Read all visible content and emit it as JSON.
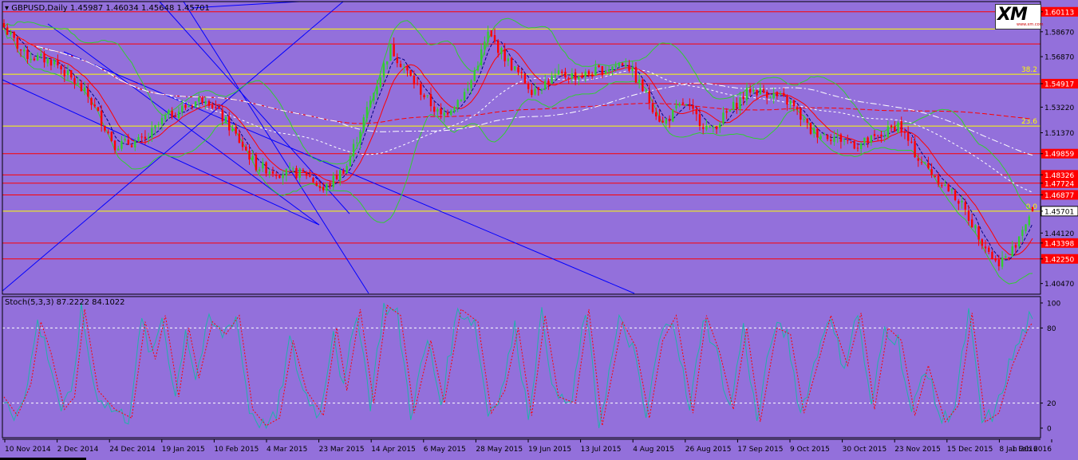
{
  "header": {
    "symbol_line": "GBPUSD,Daily  1.45987 1.46034 1.45648 1.45701"
  },
  "logo": {
    "brand": "XM",
    "url": "www.xm.com"
  },
  "colors": {
    "background": "#9370DB",
    "bull": "#32CD32",
    "bear": "#FF0000",
    "level_red": "#FF0000",
    "level_yellow": "#FFFF00",
    "trend_blue": "#0000FF",
    "ma_red": "#FF0000",
    "ma_dark": "#000080",
    "ma_white": "#FFFFFF",
    "bands": "#32CD32",
    "stoch_main": "#20B2AA",
    "stoch_signal": "#FF0000"
  },
  "chart_data": [
    {
      "type": "candlestick",
      "title": "GBPUSD,Daily",
      "ohlc_last": {
        "open": 1.45987,
        "high": 1.46034,
        "low": 1.45648,
        "close": 1.45701
      },
      "ylim": [
        1.397,
        1.6085
      ],
      "y_ticks": [
        "1.60113",
        "1.58670",
        "1.56870",
        "1.54917",
        "1.53220",
        "1.51370",
        "1.49859",
        "1.48326",
        "1.47724",
        "1.46877",
        "1.45701",
        "1.44120",
        "1.43398",
        "1.42250",
        "1.40470"
      ],
      "horizontal_levels": [
        {
          "value": 1.60113,
          "color": "red",
          "tag": true
        },
        {
          "value": 1.5887,
          "color": "yellow",
          "tag": false
        },
        {
          "value": 1.57787,
          "color": "red",
          "tag": true
        },
        {
          "value": 1.556,
          "color": "yellow",
          "tag": false,
          "label": "38.2"
        },
        {
          "value": 1.54917,
          "color": "red",
          "tag": true
        },
        {
          "value": 1.5185,
          "color": "yellow",
          "tag": false,
          "label": "23.6"
        },
        {
          "value": 1.49859,
          "color": "red",
          "tag": true
        },
        {
          "value": 1.48326,
          "color": "red",
          "tag": true
        },
        {
          "value": 1.47724,
          "color": "red",
          "tag": true
        },
        {
          "value": 1.46877,
          "color": "red",
          "tag": true
        },
        {
          "value": 1.45701,
          "color": "yellow",
          "tag": false,
          "label": "0.0"
        },
        {
          "value": 1.43398,
          "color": "red",
          "tag": true
        },
        {
          "value": 1.4225,
          "color": "red",
          "tag": true
        }
      ],
      "x_labels": [
        "10 Nov 2014",
        "2 Dec 2014",
        "24 Dec 2014",
        "19 Jan 2015",
        "10 Feb 2015",
        "4 Mar 2015",
        "23 Mar 2015",
        "14 Apr 2015",
        "6 May 2015",
        "28 May 2015",
        "19 Jun 2015",
        "13 Jul 2015",
        "4 Aug 2015",
        "26 Aug 2015",
        "17 Sep 2015",
        "9 Oct 2015",
        "30 Oct 2015",
        "23 Nov 2015",
        "15 Dec 2015",
        "8 Jan 2016",
        "1 Feb 2016"
      ],
      "close_path": [
        [
          0,
          1.59
        ],
        [
          6,
          1.57
        ],
        [
          15,
          1.565
        ],
        [
          25,
          1.54
        ],
        [
          33,
          1.505
        ],
        [
          42,
          1.508
        ],
        [
          48,
          1.525
        ],
        [
          60,
          1.54
        ],
        [
          68,
          1.515
        ],
        [
          75,
          1.49
        ],
        [
          82,
          1.485
        ],
        [
          90,
          1.484
        ],
        [
          95,
          1.472
        ],
        [
          102,
          1.49
        ],
        [
          108,
          1.53
        ],
        [
          115,
          1.575
        ],
        [
          122,
          1.55
        ],
        [
          130,
          1.525
        ],
        [
          138,
          1.545
        ],
        [
          144,
          1.585
        ],
        [
          150,
          1.565
        ],
        [
          157,
          1.545
        ],
        [
          165,
          1.555
        ],
        [
          172,
          1.555
        ],
        [
          179,
          1.56
        ],
        [
          185,
          1.565
        ],
        [
          190,
          1.545
        ],
        [
          196,
          1.52
        ],
        [
          202,
          1.535
        ],
        [
          210,
          1.515
        ],
        [
          216,
          1.53
        ],
        [
          222,
          1.545
        ],
        [
          228,
          1.542
        ],
        [
          234,
          1.535
        ],
        [
          240,
          1.515
        ],
        [
          248,
          1.51
        ],
        [
          254,
          1.505
        ],
        [
          260,
          1.51
        ],
        [
          266,
          1.52
        ],
        [
          272,
          1.495
        ],
        [
          278,
          1.48
        ],
        [
          284,
          1.465
        ],
        [
          290,
          1.44
        ],
        [
          295,
          1.42
        ],
        [
          299,
          1.424
        ],
        [
          303,
          1.445
        ],
        [
          306,
          1.457
        ]
      ]
    },
    {
      "type": "line",
      "title": "Stoch(5,3,3) 87.2222 84.1022",
      "ylim": [
        0,
        100
      ],
      "levels": [
        20,
        80
      ],
      "y_ticks": [
        "100",
        "80",
        "20",
        "0"
      ],
      "main_last": 87.2222,
      "signal_last": 84.1022,
      "signal_path": [
        [
          0,
          25
        ],
        [
          4,
          10
        ],
        [
          8,
          35
        ],
        [
          11,
          85
        ],
        [
          14,
          60
        ],
        [
          18,
          15
        ],
        [
          21,
          25
        ],
        [
          24,
          95
        ],
        [
          28,
          30
        ],
        [
          33,
          15
        ],
        [
          38,
          8
        ],
        [
          42,
          85
        ],
        [
          45,
          55
        ],
        [
          48,
          90
        ],
        [
          52,
          25
        ],
        [
          55,
          80
        ],
        [
          58,
          40
        ],
        [
          62,
          85
        ],
        [
          66,
          75
        ],
        [
          70,
          90
        ],
        [
          74,
          15
        ],
        [
          78,
          2
        ],
        [
          82,
          8
        ],
        [
          86,
          70
        ],
        [
          90,
          30
        ],
        [
          95,
          10
        ],
        [
          99,
          80
        ],
        [
          102,
          30
        ],
        [
          106,
          95
        ],
        [
          110,
          20
        ],
        [
          114,
          98
        ],
        [
          118,
          90
        ],
        [
          122,
          12
        ],
        [
          127,
          70
        ],
        [
          131,
          20
        ],
        [
          136,
          95
        ],
        [
          141,
          85
        ],
        [
          145,
          12
        ],
        [
          149,
          30
        ],
        [
          153,
          80
        ],
        [
          157,
          10
        ],
        [
          161,
          90
        ],
        [
          165,
          25
        ],
        [
          170,
          20
        ],
        [
          174,
          95
        ],
        [
          178,
          2
        ],
        [
          184,
          85
        ],
        [
          188,
          65
        ],
        [
          192,
          8
        ],
        [
          196,
          70
        ],
        [
          200,
          90
        ],
        [
          205,
          12
        ],
        [
          209,
          90
        ],
        [
          213,
          60
        ],
        [
          217,
          15
        ],
        [
          221,
          80
        ],
        [
          225,
          5
        ],
        [
          230,
          80
        ],
        [
          234,
          75
        ],
        [
          238,
          12
        ],
        [
          242,
          50
        ],
        [
          246,
          90
        ],
        [
          251,
          50
        ],
        [
          255,
          92
        ],
        [
          259,
          15
        ],
        [
          263,
          80
        ],
        [
          267,
          70
        ],
        [
          271,
          10
        ],
        [
          275,
          50
        ],
        [
          280,
          5
        ],
        [
          284,
          18
        ],
        [
          288,
          92
        ],
        [
          292,
          5
        ],
        [
          296,
          12
        ],
        [
          300,
          50
        ],
        [
          304,
          75
        ],
        [
          306,
          87
        ]
      ]
    }
  ]
}
